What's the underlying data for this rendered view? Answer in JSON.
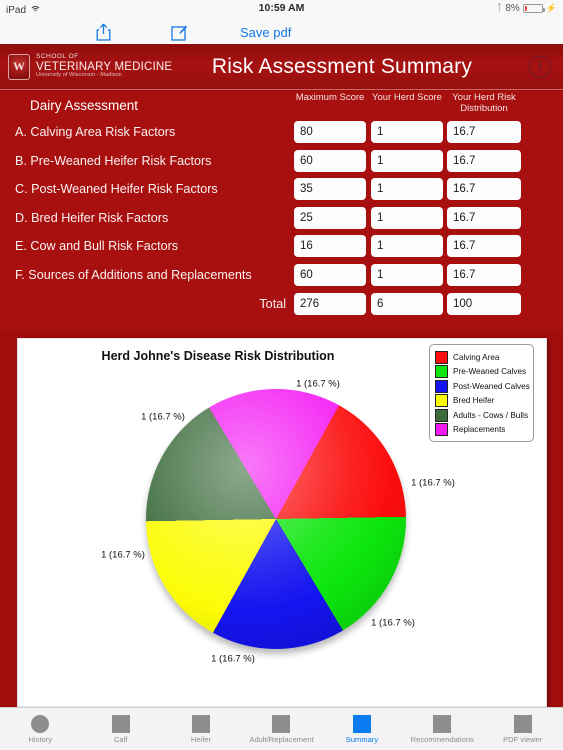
{
  "statusbar": {
    "carrier": "iPad",
    "wifi_icon": "wifi-icon",
    "time": "10:59 AM",
    "bluetooth_icon": "bluetooth-icon",
    "battery_percent": "8%",
    "charging_icon": "lightning-bolt-icon"
  },
  "toolbar": {
    "share_icon": "share-icon",
    "compose_icon": "compose-icon",
    "save_pdf_label": "Save pdf"
  },
  "header": {
    "logo_line1": "SCHOOL OF",
    "logo_line2": "VETERINARY MEDICINE",
    "logo_line3": "University of Wisconsin - Madison",
    "crest_icon": "uw-crest-icon",
    "crest_letter": "W",
    "title": "Risk Assessment Summary",
    "info_icon": "info-icon",
    "info_glyph": "i",
    "bg_color": "#a71212"
  },
  "table": {
    "section_label": "Dairy Assessment",
    "columns": [
      "Maximum Score",
      "Your Herd Score",
      "Your Herd Risk Distribution"
    ],
    "rows": [
      {
        "label": "A. Calving Area Risk Factors",
        "max": "80",
        "herd": "1",
        "dist": "16.7"
      },
      {
        "label": "B. Pre-Weaned Heifer Risk Factors",
        "max": "60",
        "herd": "1",
        "dist": "16.7"
      },
      {
        "label": "C. Post-Weaned Heifer Risk Factors",
        "max": "35",
        "herd": "1",
        "dist": "16.7"
      },
      {
        "label": "D. Bred Heifer Risk Factors",
        "max": "25",
        "herd": "1",
        "dist": "16.7"
      },
      {
        "label": "E. Cow and Bull Risk Factors",
        "max": "16",
        "herd": "1",
        "dist": "16.7"
      },
      {
        "label": "F. Sources of Additions and Replacements",
        "max": "60",
        "herd": "1",
        "dist": "16.7"
      }
    ],
    "total": {
      "label": "Total",
      "max": "276",
      "herd": "6",
      "dist": "100"
    }
  },
  "chart_data": {
    "type": "pie",
    "title": "Herd Johne's Disease Risk Distribution",
    "categories": [
      "Calving Area",
      "Pre-Weaned Calves",
      "Post-Weaned Calves",
      "Bred Heifer",
      "Adults - Cows / Bulls",
      "Replacements"
    ],
    "values": [
      1,
      1,
      1,
      1,
      1,
      1
    ],
    "percentages": [
      16.7,
      16.7,
      16.7,
      16.7,
      16.7,
      16.7
    ],
    "colors": [
      "#fc0d0d",
      "#0ce60c",
      "#1414f0",
      "#fcfc06",
      "#3c6b3c",
      "#f41af4"
    ],
    "point_labels": [
      "1 (16.7 %)",
      "1 (16.7 %)",
      "1 (16.7 %)",
      "1 (16.7 %)",
      "1 (16.7 %)",
      "1 (16.7 %)"
    ],
    "legend_position": "top-right",
    "grid": false,
    "xlabel": "",
    "ylabel": ""
  },
  "tabbar": {
    "items": [
      {
        "label": "History",
        "icon": "history-icon",
        "active": false
      },
      {
        "label": "Calf",
        "icon": "calf-icon",
        "active": false
      },
      {
        "label": "Heifer",
        "icon": "heifer-icon",
        "active": false
      },
      {
        "label": "Adult/Replacement",
        "icon": "adult-replacement-icon",
        "active": false
      },
      {
        "label": "Summary",
        "icon": "summary-icon",
        "active": true
      },
      {
        "label": "Recommendations",
        "icon": "recommendations-icon",
        "active": false
      },
      {
        "label": "PDF viewer",
        "icon": "pdf-viewer-icon",
        "active": false
      }
    ],
    "active_color": "#0a7bf0"
  }
}
